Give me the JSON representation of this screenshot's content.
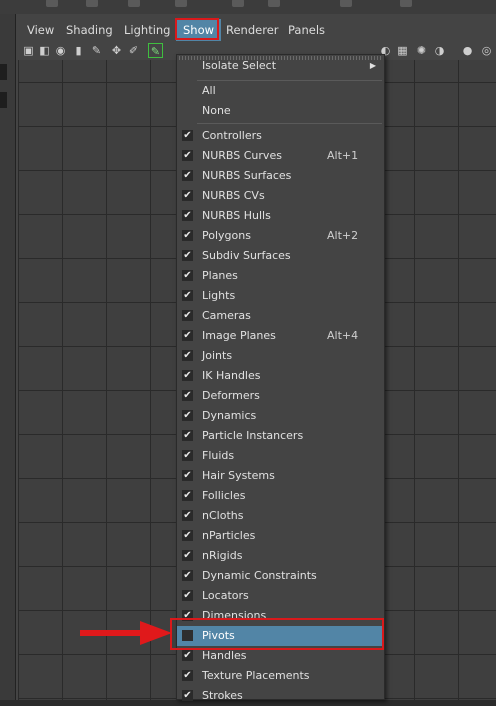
{
  "menubar": {
    "items": [
      {
        "label": "View"
      },
      {
        "label": "Shading"
      },
      {
        "label": "Lighting"
      },
      {
        "label": "Show"
      },
      {
        "label": "Renderer"
      },
      {
        "label": "Panels"
      }
    ]
  },
  "show_menu": {
    "isolate_select": "Isolate Select",
    "all": "All",
    "none": "None",
    "items": [
      {
        "label": "Controllers",
        "checked": true,
        "shortcut": ""
      },
      {
        "label": "NURBS Curves",
        "checked": true,
        "shortcut": "Alt+1"
      },
      {
        "label": "NURBS Surfaces",
        "checked": true,
        "shortcut": ""
      },
      {
        "label": "NURBS CVs",
        "checked": true,
        "shortcut": ""
      },
      {
        "label": "NURBS Hulls",
        "checked": true,
        "shortcut": ""
      },
      {
        "label": "Polygons",
        "checked": true,
        "shortcut": "Alt+2"
      },
      {
        "label": "Subdiv Surfaces",
        "checked": true,
        "shortcut": ""
      },
      {
        "label": "Planes",
        "checked": true,
        "shortcut": ""
      },
      {
        "label": "Lights",
        "checked": true,
        "shortcut": ""
      },
      {
        "label": "Cameras",
        "checked": true,
        "shortcut": ""
      },
      {
        "label": "Image Planes",
        "checked": true,
        "shortcut": "Alt+4"
      },
      {
        "label": "Joints",
        "checked": true,
        "shortcut": ""
      },
      {
        "label": "IK Handles",
        "checked": true,
        "shortcut": ""
      },
      {
        "label": "Deformers",
        "checked": true,
        "shortcut": ""
      },
      {
        "label": "Dynamics",
        "checked": true,
        "shortcut": ""
      },
      {
        "label": "Particle Instancers",
        "checked": true,
        "shortcut": ""
      },
      {
        "label": "Fluids",
        "checked": true,
        "shortcut": ""
      },
      {
        "label": "Hair Systems",
        "checked": true,
        "shortcut": ""
      },
      {
        "label": "Follicles",
        "checked": true,
        "shortcut": ""
      },
      {
        "label": "nCloths",
        "checked": true,
        "shortcut": ""
      },
      {
        "label": "nParticles",
        "checked": true,
        "shortcut": ""
      },
      {
        "label": "nRigids",
        "checked": true,
        "shortcut": ""
      },
      {
        "label": "Dynamic Constraints",
        "checked": true,
        "shortcut": ""
      },
      {
        "label": "Locators",
        "checked": true,
        "shortcut": ""
      },
      {
        "label": "Dimensions",
        "checked": true,
        "shortcut": ""
      },
      {
        "label": "Pivots",
        "checked": false,
        "shortcut": "",
        "highlighted": true
      },
      {
        "label": "Handles",
        "checked": true,
        "shortcut": ""
      },
      {
        "label": "Texture Placements",
        "checked": true,
        "shortcut": ""
      },
      {
        "label": "Strokes",
        "checked": true,
        "shortcut": ""
      }
    ]
  },
  "colors": {
    "highlight": "#5285a6",
    "annotation_red": "#d9191b",
    "menu_bg": "#444444",
    "viewport_bg": "#3f3f3f"
  }
}
